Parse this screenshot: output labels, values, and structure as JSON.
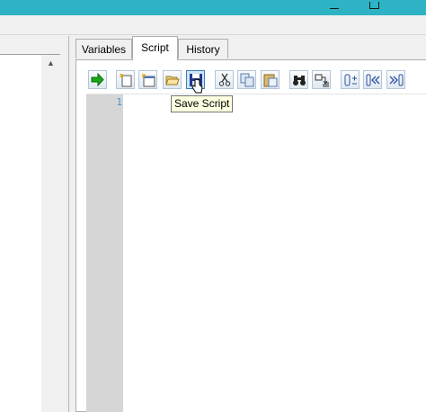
{
  "window": {
    "minimize_icon": "minimize-icon",
    "maximize_icon": "maximize-icon",
    "accent_color": "#2db3c4"
  },
  "tabs": [
    {
      "label": "Variables",
      "active": false
    },
    {
      "label": "Script",
      "active": true
    },
    {
      "label": "History",
      "active": false
    }
  ],
  "toolbar": {
    "buttons": [
      {
        "name": "run-script-button",
        "icon": "green-arrow-icon"
      },
      {
        "name": "new-script-button",
        "icon": "new-document-icon"
      },
      {
        "name": "new-window-button",
        "icon": "new-window-icon"
      },
      {
        "name": "open-script-button",
        "icon": "folder-open-icon"
      },
      {
        "name": "save-script-button",
        "icon": "floppy-disk-icon",
        "state": "pressed"
      },
      {
        "name": "cut-button",
        "icon": "scissors-icon"
      },
      {
        "name": "copy-button",
        "icon": "copy-icon"
      },
      {
        "name": "paste-button",
        "icon": "paste-icon"
      },
      {
        "name": "find-button",
        "icon": "binoculars-icon"
      },
      {
        "name": "replace-button",
        "icon": "replace-icon"
      },
      {
        "name": "toggle-comment-button",
        "icon": "comment-toggle-icon"
      },
      {
        "name": "unindent-button",
        "icon": "unindent-icon"
      },
      {
        "name": "indent-button",
        "icon": "indent-icon"
      }
    ]
  },
  "editor": {
    "line_numbers": [
      "1"
    ],
    "content": ""
  },
  "tooltip": {
    "text": "Save Script"
  }
}
